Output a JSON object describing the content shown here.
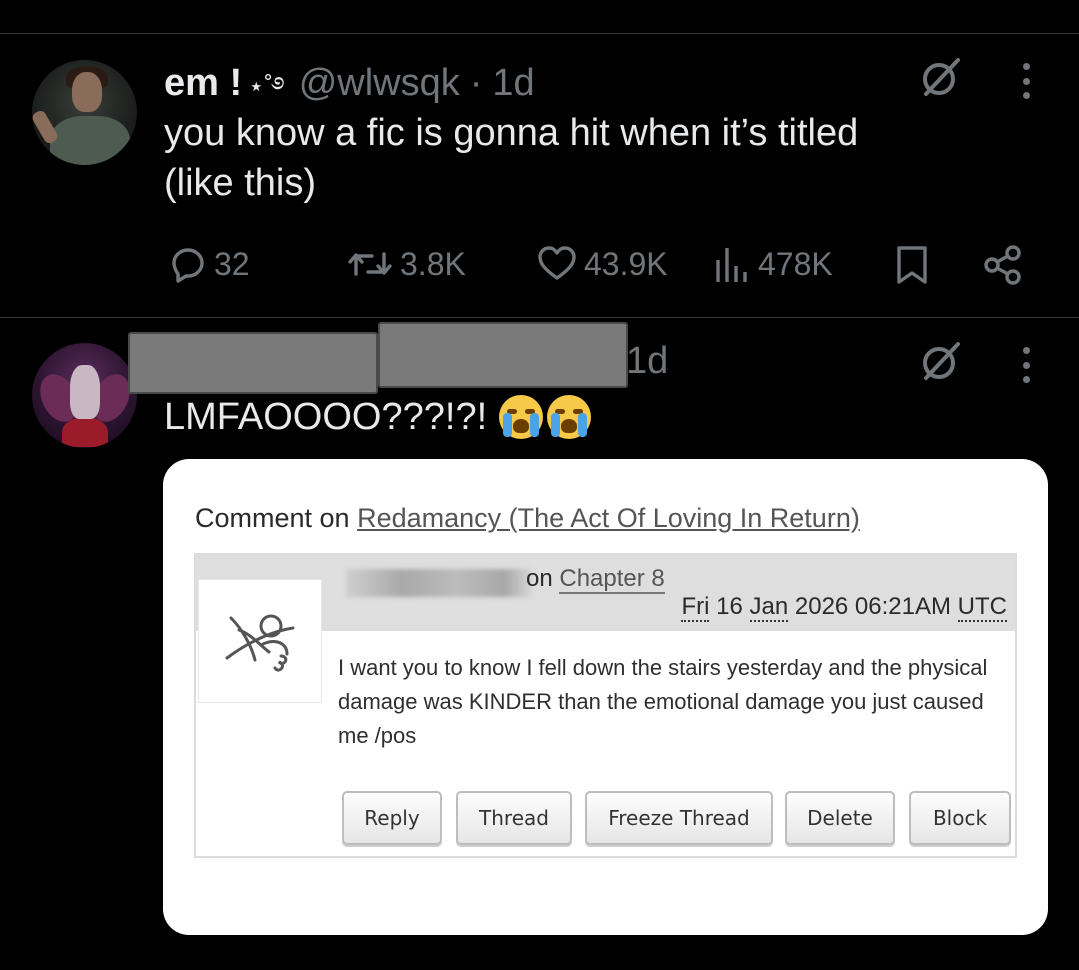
{
  "tweet1": {
    "display_name": "em !",
    "name_decoration": "⋆˚࿔",
    "handle": "@wlwsqk",
    "separator": "·",
    "time": "1d",
    "text_line1": "you know a fic is gonna hit when it’s titled",
    "text_line2": "(like this)",
    "actions": {
      "replies": "32",
      "reposts": "3.8K",
      "likes": "43.9K",
      "views": "478K"
    }
  },
  "tweet2": {
    "time": "1d",
    "text": "LMFAOOOO???!?!",
    "emoji": [
      "loudly-crying-face",
      "loudly-crying-face"
    ]
  },
  "embed": {
    "comment_prefix": "Comment on",
    "work_title": "Redamancy (The Act Of Loving In Return)",
    "on_label": "on",
    "chapter": "Chapter 8",
    "date_day": "Fri",
    "date_rest": "16",
    "date_month": "Jan",
    "date_tail": "2026 06:21AM",
    "timezone": "UTC",
    "comment_text": "I want you to know I fell down the stairs yesterday and the physical damage was KINDER than the emotional damage you just caused me /pos",
    "buttons": {
      "reply": "Reply",
      "thread": "Thread",
      "freeze": "Freeze Thread",
      "delete": "Delete",
      "block": "Block"
    }
  },
  "colors": {
    "background": "#000000",
    "text_primary": "#e7e9ea",
    "text_secondary": "#71767b",
    "divider": "#2f3336",
    "card_bg": "#ffffff"
  }
}
